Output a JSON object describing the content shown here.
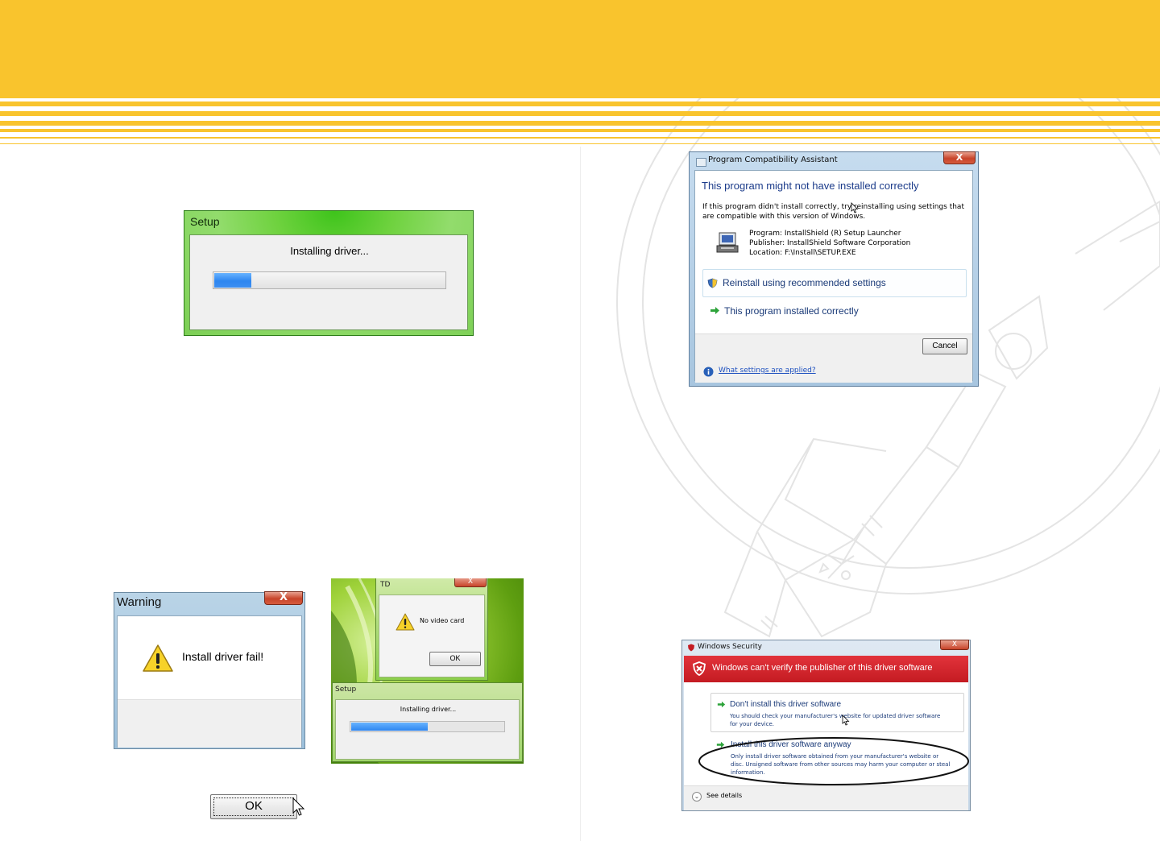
{
  "setup_dialog": {
    "title": "Setup",
    "message": "Installing driver...",
    "progress": 0.16
  },
  "warning_dialog": {
    "title": "Warning",
    "close_glyph": "X",
    "message": "Install driver fail!",
    "ok_label": "OK"
  },
  "td_dialog": {
    "title": "TD",
    "close_glyph": "X",
    "message": "No video card",
    "ok_label": "OK",
    "setup_title": "Setup",
    "setup_message": "Installing driver...",
    "setup_progress": 0.5
  },
  "pca_dialog": {
    "title": "Program Compatibility Assistant",
    "close_glyph": "X",
    "heading": "This program might not have installed correctly",
    "description_line1": "If this program didn't install correctly, try reinstalling using settings that",
    "description_line2": "are compatible with this version of Windows.",
    "program": "Program: InstallShield (R) Setup Launcher",
    "publisher": "Publisher: InstallShield Software Corporation",
    "location": "Location: F:\\Install\\SETUP.EXE",
    "option_reinstall": "Reinstall using recommended settings",
    "option_installed": "This program installed correctly",
    "cancel_label": "Cancel",
    "link": "What settings are applied?"
  },
  "security_dialog": {
    "title": "Windows Security",
    "close_glyph": "X",
    "banner": "Windows can't verify the publisher of this driver software",
    "option_dont": "Don't install this driver software",
    "option_dont_desc_line1": "You should check your manufacturer's website for updated driver software",
    "option_dont_desc_line2": "for your device.",
    "option_install": "Install this driver software anyway",
    "option_install_desc_line1": "Only install driver software obtained from your manufacturer's website or",
    "option_install_desc_line2": "disc. Unsigned software from other sources may harm your computer or steal",
    "option_install_desc_line3": "information.",
    "details_label": "See details"
  },
  "colors": {
    "header_yellow": "#f9c42d",
    "progress_blue": "#2e86f0",
    "security_red": "#c41b22",
    "link_blue": "#1c4fbf"
  }
}
